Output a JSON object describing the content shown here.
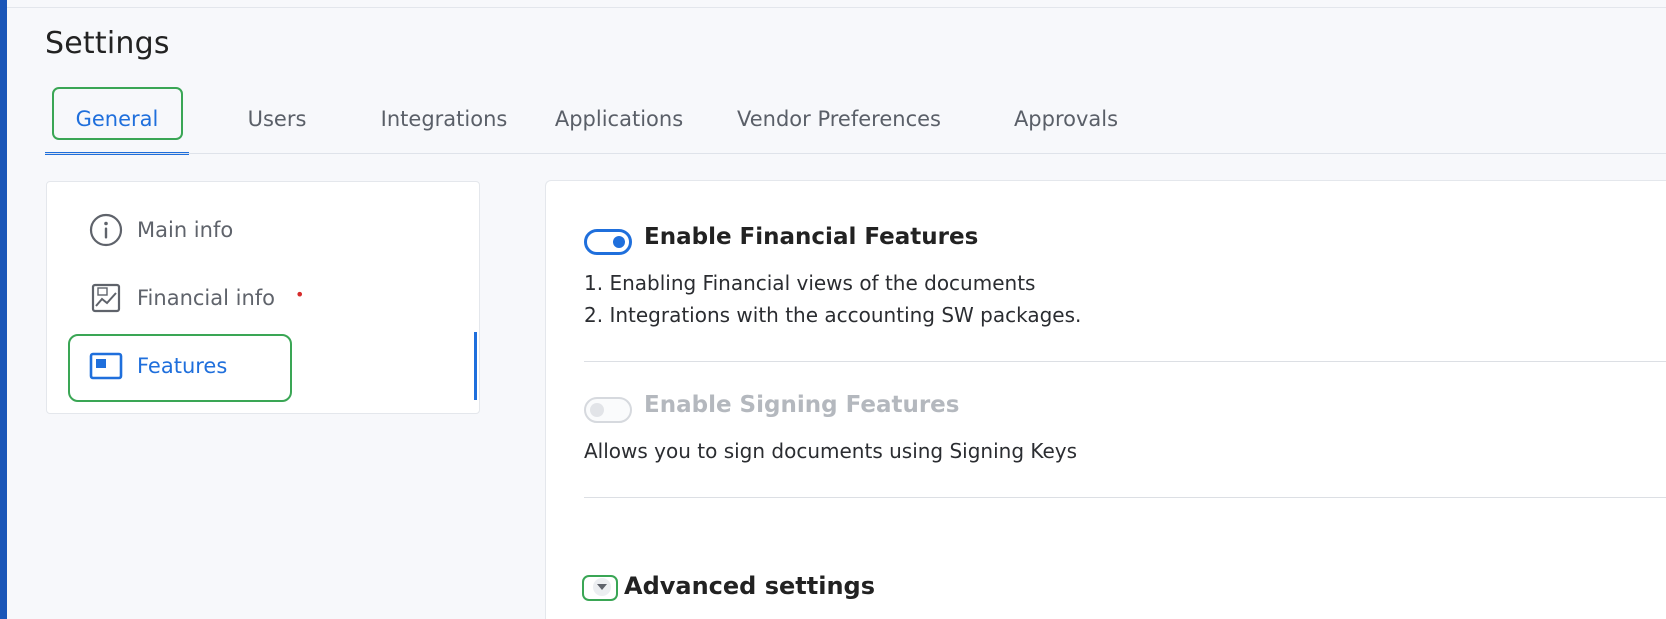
{
  "page": {
    "title": "Settings"
  },
  "tabs": [
    {
      "label": "General",
      "active": true
    },
    {
      "label": "Users",
      "active": false
    },
    {
      "label": "Integrations",
      "active": false
    },
    {
      "label": "Applications",
      "active": false
    },
    {
      "label": "Vendor Preferences",
      "active": false
    },
    {
      "label": "Approvals",
      "active": false
    }
  ],
  "sidebar": {
    "items": [
      {
        "label": "Main info",
        "icon": "info-circle-icon",
        "active": false
      },
      {
        "label": "Financial info",
        "icon": "financial-chart-icon",
        "required_marker": "•",
        "active": false
      },
      {
        "label": "Features",
        "icon": "features-window-icon",
        "active": true
      }
    ]
  },
  "features": {
    "financial": {
      "title": "Enable Financial Features",
      "enabled": true,
      "lines": [
        "1. Enabling Financial views of the documents",
        "2. Integrations with the accounting SW packages."
      ]
    },
    "signing": {
      "title": "Enable Signing Features",
      "enabled": false,
      "description": "Allows you to sign documents using Signing Keys"
    }
  },
  "advanced": {
    "title": "Advanced settings",
    "expanded": false
  },
  "colors": {
    "accent": "#1f6fdc",
    "highlight": "#3aa655",
    "required": "#d62c2c",
    "rail": "#1a56b8"
  }
}
